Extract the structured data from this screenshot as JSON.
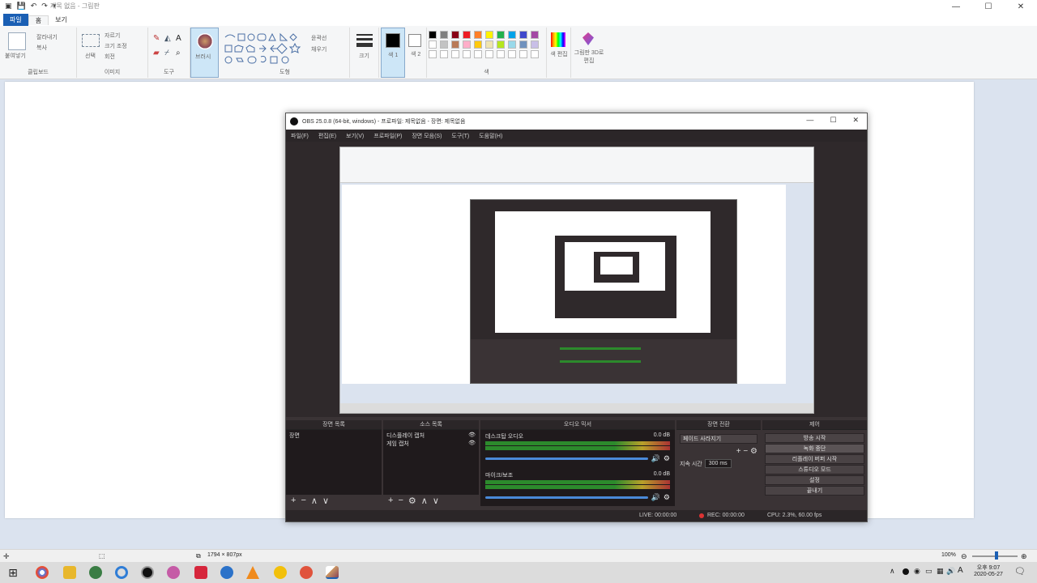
{
  "paint": {
    "title": "제목 없음 - 그림판",
    "tabs": [
      "파일",
      "홈",
      "보기"
    ],
    "ribbon": {
      "clipboard": {
        "paste": "붙여넣기",
        "cut": "잘라내기",
        "copy": "복사",
        "label": "클립보드"
      },
      "image": {
        "select": "선택",
        "crop": "자르기",
        "resize": "크기 조정",
        "rotate": "회전",
        "label": "이미지"
      },
      "tools": {
        "label": "도구"
      },
      "brushes": {
        "label": "브러시"
      },
      "shapes": {
        "outline": "윤곽선",
        "fill": "채우기",
        "label": "도형"
      },
      "size": {
        "label": "크기"
      },
      "color1": {
        "label": "색 1"
      },
      "color2": {
        "label": "색 2"
      },
      "colors": {
        "label": "색"
      },
      "edit_colors": {
        "label": "색 편집"
      },
      "paint3d": {
        "label": "그림판 3D로 편집"
      }
    },
    "palette": [
      "#000000",
      "#7f7f7f",
      "#880015",
      "#ed1c24",
      "#ff7f27",
      "#fff200",
      "#22b14c",
      "#00a2e8",
      "#3f48cc",
      "#a349a4",
      "#ffffff",
      "#c3c3c3",
      "#b97a57",
      "#ffaec9",
      "#ffc90e",
      "#efe4b0",
      "#b5e61d",
      "#99d9ea",
      "#7092be",
      "#c8bfe7"
    ],
    "status": {
      "dimensions": "1794 × 807px",
      "zoom": "100%"
    }
  },
  "obs": {
    "title": "OBS 25.0.8 (64-bit, windows) - 프로파일: 제목없음 - 장면: 제목없음",
    "menu": [
      "파일(F)",
      "편집(E)",
      "보기(V)",
      "프로파일(P)",
      "장면 모음(S)",
      "도구(T)",
      "도움말(H)"
    ],
    "docks": {
      "scenes": {
        "title": "장면 목록",
        "items": [
          "장면"
        ]
      },
      "sources": {
        "title": "소스 목록",
        "items": [
          "디스플레이 캡처",
          "게임 캡처"
        ]
      },
      "mixer": {
        "title": "오디오 믹서",
        "channels": [
          {
            "name": "데스크탑 오디오",
            "db": "0.0 dB"
          },
          {
            "name": "마이크/보조",
            "db": "0.0 dB"
          }
        ]
      },
      "transitions": {
        "title": "장면 전환",
        "type": "페이드 사라지기",
        "duration_label": "지속 시간",
        "duration": "300 ms"
      },
      "controls": {
        "title": "제어",
        "buttons": [
          "방송 시작",
          "녹화 중단",
          "리플레이 버퍼 시작",
          "스튜디오 모드",
          "설정",
          "끝내기"
        ]
      }
    },
    "status": {
      "live": "LIVE: 00:00:00",
      "rec": "REC: 00:00:00",
      "cpu": "CPU: 2.3%, 60.00 fps"
    }
  },
  "taskbar": {
    "time": "오후 9:07",
    "date": "2020-05-27",
    "ime": "A"
  }
}
